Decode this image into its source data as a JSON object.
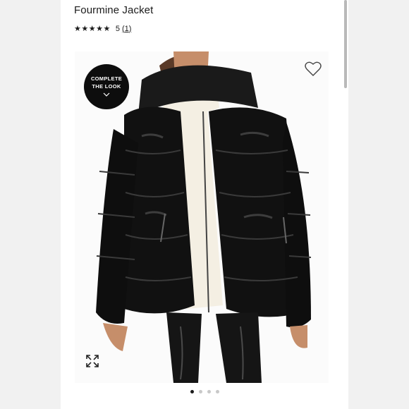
{
  "product": {
    "title": "Fourmine Jacket",
    "stars": "★★★★★",
    "rating_value": "5",
    "review_count": "1",
    "rating_out_of": 5
  },
  "badge": {
    "line1": "COMPLETE",
    "line2": "THE LOOK"
  },
  "icons": {
    "wishlist": "heart-icon",
    "expand": "expand-icon",
    "badge_arrow": "chevron-down-icon"
  },
  "carousel": {
    "total_images": 4,
    "active_index": 1
  },
  "colors": {
    "badge_bg": "#0d0d0d",
    "jacket": "#111111",
    "sweater": "#f4efe3",
    "active_dot": "#1b1b1b",
    "inactive_dot": "#c8c8c8"
  }
}
